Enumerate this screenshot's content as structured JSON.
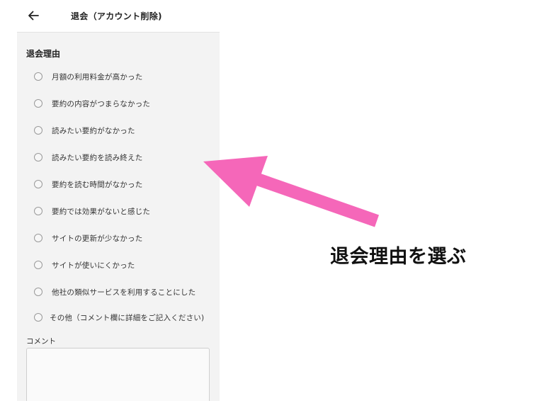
{
  "header": {
    "title": "退会（アカウント削除)",
    "back_icon": "arrow-left-icon"
  },
  "form": {
    "section_label": "退会理由",
    "options": [
      "月額の利用料金が高かった",
      "要約の内容がつまらなかった",
      "読みたい要約がなかった",
      "読みたい要約を読み終えた",
      "要約を読む時間がなかった",
      "要約では効果がないと感じた",
      "サイトの更新が少なかった",
      "サイトが使いにくかった",
      "他社の類似サービスを利用することにした",
      "その他（コメント欄に詳細をご記入ください)"
    ],
    "comment_label": "コメント",
    "comment_value": ""
  },
  "annotation": {
    "text": "退会理由を選ぶ",
    "arrow_color": "#f567b9"
  }
}
